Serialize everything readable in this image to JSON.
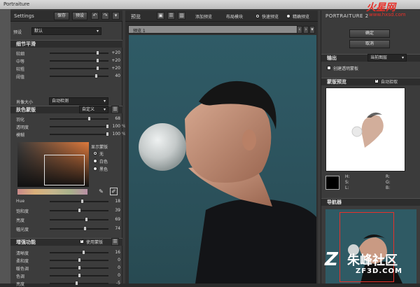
{
  "window": {
    "title": "Portraiture"
  },
  "left_panel": {
    "settings_label": "Settings",
    "save_label": "保存",
    "preset_label": "预设",
    "undo_icon": "undo-icon",
    "redo_icon": "redo-icon",
    "preset_row": {
      "label": "预设",
      "value": "默认"
    },
    "detail_section": {
      "title": "细节平滑",
      "sliders": [
        {
          "label": "较细",
          "value": "+20",
          "fraction": 0.82
        },
        {
          "label": "中等",
          "value": "+20",
          "fraction": 0.82
        },
        {
          "label": "较粗",
          "value": "+20",
          "fraction": 0.82
        },
        {
          "label": "阈值",
          "value": "40",
          "fraction": 0.8
        }
      ],
      "portrait_size": {
        "label": "肖像大小",
        "value": "自动检测"
      }
    },
    "skin_mask_section": {
      "title": "肤色蒙版",
      "mode": "自定义",
      "sliders": [
        {
          "label": "羽化",
          "value": "68",
          "unit": "",
          "fraction": 0.68
        },
        {
          "label": "透明度",
          "value": "100",
          "unit": "%",
          "fraction": 1.0
        },
        {
          "label": "模糊",
          "value": "100",
          "unit": "%",
          "fraction": 1.0
        }
      ],
      "show_mask_label": "显示蒙版",
      "mask_options": [
        "无",
        "白色",
        "黑色"
      ],
      "mask_selected": 0,
      "hue_sliders": [
        {
          "label": "Hue",
          "value": "18",
          "fraction": 0.55
        },
        {
          "label": "饱和度",
          "value": "39",
          "fraction": 0.5
        },
        {
          "label": "亮度",
          "value": "69",
          "fraction": 0.62
        },
        {
          "label": "幅光度",
          "value": "74",
          "fraction": 0.6
        }
      ]
    },
    "enhance_section": {
      "title": "增强功能",
      "use_mask_label": "使用蒙版",
      "use_mask_checked": true,
      "sliders": [
        {
          "label": "清晰度",
          "value": "16",
          "fraction": 0.58
        },
        {
          "label": "柔和度",
          "value": "0",
          "fraction": 0.5
        },
        {
          "label": "暖色调",
          "value": "0",
          "fraction": 0.5
        },
        {
          "label": "色调",
          "value": "0",
          "fraction": 0.5
        },
        {
          "label": "亮度",
          "value": "-5",
          "fraction": 0.45
        }
      ]
    }
  },
  "center_panel": {
    "preview_label": "预览",
    "add_preview_label": "添加预览",
    "layout_label": "布局模块",
    "quick_preview_label": "快速预览",
    "precise_preview_label": "精确预览",
    "tab_label": "预览 1",
    "quick_selected": true
  },
  "right_panel": {
    "title": "PORTRAITURE 2",
    "ok_label": "确定",
    "cancel_label": "取消",
    "output_section": {
      "title": "输出",
      "value": "当前图层",
      "create_mask_label": "创建透明蒙板"
    },
    "mask_preview_section": {
      "title": "蒙版预览",
      "auto_pick_label": "自动拾取"
    },
    "color_readout": {
      "h": "H:",
      "s": "S:",
      "l": "L:",
      "r": "R:",
      "g": "G:",
      "b": "B:"
    },
    "navigator_title": "导航器"
  },
  "watermarks": {
    "top_text": "火星网",
    "top_url": "www.hxsd.com",
    "bottom_text": "朱峰社区",
    "bottom_url": "ZF3D.COM"
  },
  "colors": {
    "accent_red": "#e8312a",
    "panel": "#3a3a3a",
    "dark": "#2b2b2b"
  }
}
